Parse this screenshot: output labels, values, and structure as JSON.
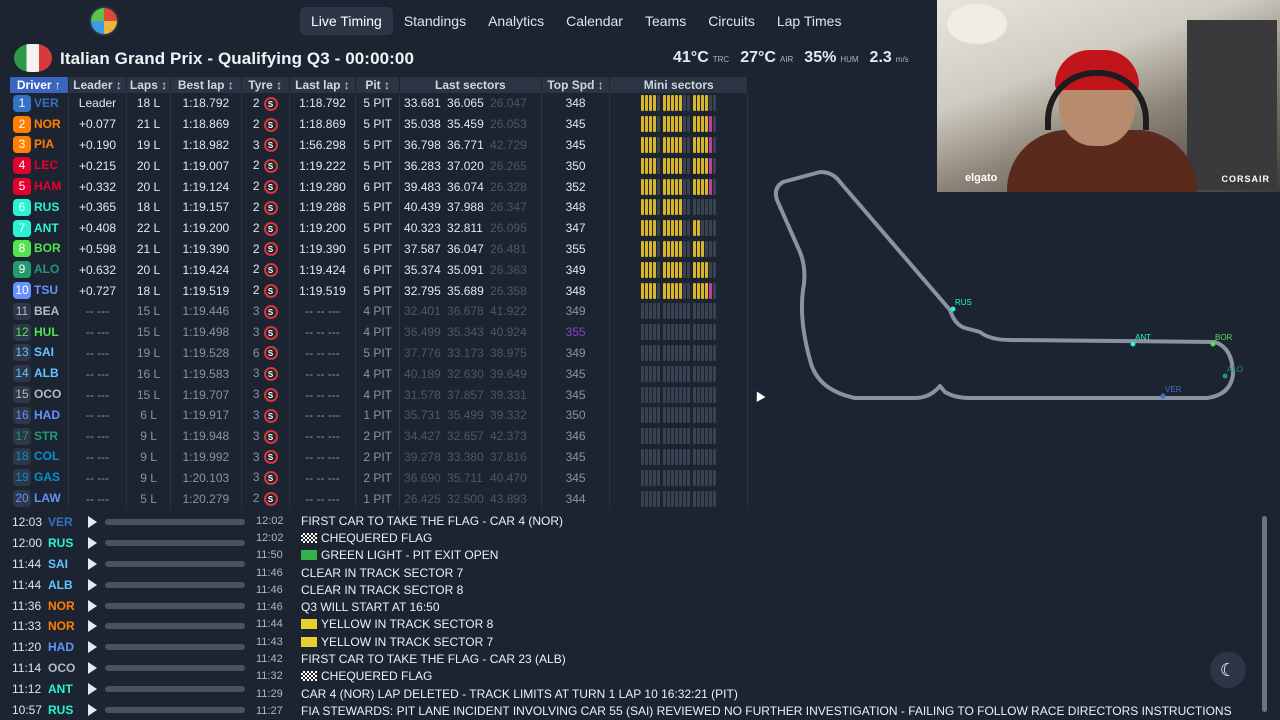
{
  "nav": {
    "items": [
      "Live Timing",
      "Standings",
      "Analytics",
      "Calendar",
      "Teams",
      "Circuits",
      "Lap Times"
    ],
    "active_index": 0
  },
  "header": {
    "session_title": "Italian Grand Prix - Qualifying Q3 - 00:00:00",
    "track_temp": "41°C",
    "track_temp_unit": "TRC",
    "air_temp": "27°C",
    "air_temp_unit": "AIR",
    "humidity": "35%",
    "humidity_unit": "HUM",
    "wind": "2.3",
    "wind_unit": "m/s"
  },
  "table": {
    "headers": [
      "Driver ↑",
      "Leader ↕",
      "Laps ↕",
      "Best lap ↕",
      "Tyre ↕",
      "Last lap ↕",
      "Pit ↕",
      "Last sectors",
      "Top Spd ↕",
      "Mini sectors"
    ],
    "rows": [
      {
        "pos": "1",
        "code": "VER",
        "color": "#3671c6",
        "leader": "Leader",
        "laps": "18 L",
        "best": "1:18.792",
        "best_cls": "purple",
        "tyre_n": "2",
        "last": "1:18.792",
        "last_cls": "purple",
        "pit": "5 PIT",
        "s1": "33.681",
        "s2": "36.065",
        "s3": "26.047",
        "spd": "348",
        "out": false,
        "minis": "yyyy yyyyy yyyy"
      },
      {
        "pos": "2",
        "code": "NOR",
        "color": "#ff8000",
        "leader": "+0.077",
        "laps": "21 L",
        "best": "1:18.869",
        "best_cls": "",
        "tyre_n": "2",
        "last": "1:18.869",
        "last_cls": "green",
        "pit": "5 PIT",
        "s1": "35.038",
        "s2": "35.459",
        "s3": "26.053",
        "spd": "345",
        "out": false,
        "minis": "yyyy yyyyy yyyyp"
      },
      {
        "pos": "3",
        "code": "PIA",
        "color": "#ff8000",
        "leader": "+0.190",
        "laps": "19 L",
        "best": "1:18.982",
        "best_cls": "",
        "tyre_n": "3",
        "last": "1:56.298",
        "last_cls": "",
        "pit": "5 PIT",
        "s1": "36.798",
        "s2": "36.771",
        "s3": "42.729",
        "spd": "345",
        "out": false,
        "minis": "yyyy yyyyy yyyyp"
      },
      {
        "pos": "4",
        "code": "LEC",
        "color": "#e8002d",
        "leader": "+0.215",
        "laps": "20 L",
        "best": "1:19.007",
        "best_cls": "",
        "tyre_n": "2",
        "last": "1:19.222",
        "last_cls": "",
        "pit": "5 PIT",
        "s1": "36.283",
        "s2": "37.020",
        "s3": "26.265",
        "spd": "350",
        "out": false,
        "minis": "yyyy yyyyy yyyyp"
      },
      {
        "pos": "5",
        "code": "HAM",
        "color": "#e8002d",
        "leader": "+0.332",
        "laps": "20 L",
        "best": "1:19.124",
        "best_cls": "",
        "tyre_n": "2",
        "last": "1:19.280",
        "last_cls": "",
        "pit": "6 PIT",
        "s1": "39.483",
        "s2": "36.074",
        "s3": "26.328",
        "spd": "352",
        "out": false,
        "minis": "yyyy yyyyy yyyyp"
      },
      {
        "pos": "6",
        "code": "RUS",
        "color": "#27f4d2",
        "leader": "+0.365",
        "laps": "18 L",
        "best": "1:19.157",
        "best_cls": "",
        "tyre_n": "2",
        "last": "1:19.288",
        "last_cls": "",
        "pit": "5 PIT",
        "s1": "40.439",
        "s2": "37.988",
        "s3": "26.347",
        "spd": "348",
        "out": false,
        "minis": "yyyy yyyyy ----"
      },
      {
        "pos": "7",
        "code": "ANT",
        "color": "#27f4d2",
        "leader": "+0.408",
        "laps": "22 L",
        "best": "1:19.200",
        "best_cls": "",
        "tyre_n": "2",
        "last": "1:19.200",
        "last_cls": "green",
        "pit": "5 PIT",
        "s1": "40.323",
        "s2": "32.811",
        "s3": "26.095",
        "spd": "347",
        "out": false,
        "minis": "yyyy yyyyy yy--"
      },
      {
        "pos": "8",
        "code": "BOR",
        "color": "#52e252",
        "leader": "+0.598",
        "laps": "21 L",
        "best": "1:19.390",
        "best_cls": "",
        "tyre_n": "2",
        "last": "1:19.390",
        "last_cls": "green",
        "pit": "5 PIT",
        "s1": "37.587",
        "s2": "36.047",
        "s3": "26.481",
        "spd": "355",
        "out": false,
        "minis": "yyyy yyyyy yyy-"
      },
      {
        "pos": "9",
        "code": "ALO",
        "color": "#229971",
        "leader": "+0.632",
        "laps": "20 L",
        "best": "1:19.424",
        "best_cls": "",
        "tyre_n": "2",
        "last": "1:19.424",
        "last_cls": "green",
        "pit": "6 PIT",
        "s1": "35.374",
        "s2": "35.091",
        "s3": "26.363",
        "spd": "349",
        "out": false,
        "minis": "yyyy yyyyy yyyy"
      },
      {
        "pos": "10",
        "code": "TSU",
        "color": "#6692ff",
        "leader": "+0.727",
        "laps": "18 L",
        "best": "1:19.519",
        "best_cls": "",
        "tyre_n": "2",
        "last": "1:19.519",
        "last_cls": "green",
        "pit": "5 PIT",
        "s1": "32.795",
        "s2": "35.689",
        "s3": "26.358",
        "spd": "348",
        "out": false,
        "minis": "yyyy yyyyy yyyyp"
      },
      {
        "pos": "11",
        "code": "BEA",
        "color": "#b6babd",
        "leader": "-- ---",
        "laps": "15 L",
        "best": "1:19.446",
        "best_cls": "",
        "tyre_n": "3",
        "last": "-- -- ---",
        "last_cls": "",
        "pit": "4 PIT",
        "s1": "32.401",
        "s2": "36.678",
        "s3": "41.922",
        "spd": "349",
        "out": true,
        "minis": "---- ----- ----"
      },
      {
        "pos": "12",
        "code": "HUL",
        "color": "#52e252",
        "leader": "-- ---",
        "laps": "15 L",
        "best": "1:19.498",
        "best_cls": "",
        "tyre_n": "3",
        "last": "-- -- ---",
        "last_cls": "",
        "pit": "4 PIT",
        "s1": "36.499",
        "s2": "35.343",
        "s3": "40.924",
        "spd": "355",
        "out": true,
        "minis": "---- ----- ----"
      },
      {
        "pos": "13",
        "code": "SAI",
        "color": "#64c4ff",
        "leader": "-- ---",
        "laps": "19 L",
        "best": "1:19.528",
        "best_cls": "",
        "tyre_n": "6",
        "last": "-- -- ---",
        "last_cls": "",
        "pit": "5 PIT",
        "s1": "37.776",
        "s2": "33.173",
        "s3": "38.975",
        "spd": "349",
        "out": true,
        "minis": "---- ----- ----"
      },
      {
        "pos": "14",
        "code": "ALB",
        "color": "#64c4ff",
        "leader": "-- ---",
        "laps": "16 L",
        "best": "1:19.583",
        "best_cls": "",
        "tyre_n": "3",
        "last": "-- -- ---",
        "last_cls": "",
        "pit": "4 PIT",
        "s1": "40.189",
        "s2": "32.630",
        "s3": "39.649",
        "spd": "345",
        "out": true,
        "minis": "---- ----- ----"
      },
      {
        "pos": "15",
        "code": "OCO",
        "color": "#b6babd",
        "leader": "-- ---",
        "laps": "15 L",
        "best": "1:19.707",
        "best_cls": "",
        "tyre_n": "3",
        "last": "-- -- ---",
        "last_cls": "",
        "pit": "4 PIT",
        "s1": "31.578",
        "s2": "37.857",
        "s3": "39.331",
        "spd": "345",
        "out": true,
        "minis": "---- ----- ----"
      },
      {
        "pos": "16",
        "code": "HAD",
        "color": "#6692ff",
        "leader": "-- ---",
        "laps": "6 L",
        "best": "1:19.917",
        "best_cls": "",
        "tyre_n": "3",
        "last": "-- -- ---",
        "last_cls": "",
        "pit": "1 PIT",
        "s1": "35.731",
        "s2": "35.499",
        "s3": "39.332",
        "spd": "350",
        "out": true,
        "minis": "---- ----- ----"
      },
      {
        "pos": "17",
        "code": "STR",
        "color": "#229971",
        "leader": "-- ---",
        "laps": "9 L",
        "best": "1:19.948",
        "best_cls": "",
        "tyre_n": "3",
        "last": "-- -- ---",
        "last_cls": "",
        "pit": "2 PIT",
        "s1": "34.427",
        "s2": "32.657",
        "s3": "42.373",
        "spd": "346",
        "out": true,
        "minis": "---- ----- ----"
      },
      {
        "pos": "18",
        "code": "COL",
        "color": "#0093cc",
        "leader": "-- ---",
        "laps": "9 L",
        "best": "1:19.992",
        "best_cls": "",
        "tyre_n": "3",
        "last": "-- -- ---",
        "last_cls": "",
        "pit": "2 PIT",
        "s1": "39.278",
        "s2": "33.380",
        "s3": "37.816",
        "spd": "345",
        "out": true,
        "minis": "---- ----- ----"
      },
      {
        "pos": "19",
        "code": "GAS",
        "color": "#0093cc",
        "leader": "-- ---",
        "laps": "9 L",
        "best": "1:20.103",
        "best_cls": "",
        "tyre_n": "3",
        "last": "-- -- ---",
        "last_cls": "",
        "pit": "2 PIT",
        "s1": "36.690",
        "s2": "35.711",
        "s3": "40.470",
        "spd": "345",
        "out": true,
        "minis": "---- ----- ----"
      },
      {
        "pos": "20",
        "code": "LAW",
        "color": "#6692ff",
        "leader": "-- ---",
        "laps": "5 L",
        "best": "1:20.279",
        "best_cls": "",
        "tyre_n": "2",
        "last": "-- -- ---",
        "last_cls": "",
        "pit": "1 PIT",
        "s1": "26.425",
        "s2": "32.500",
        "s3": "43.893",
        "spd": "344",
        "out": true,
        "minis": "---- ----- ----"
      }
    ]
  },
  "track": {
    "labels": [
      {
        "code": "RUS",
        "color": "#27f4d2"
      },
      {
        "code": "ANT",
        "color": "#27f4d2"
      },
      {
        "code": "BOR",
        "color": "#52e252"
      },
      {
        "code": "ALO",
        "color": "#229971"
      },
      {
        "code": "VER",
        "color": "#3671c6"
      }
    ]
  },
  "webcam": {
    "brand_left": "elgato",
    "brand_right": "CORSAIR"
  },
  "lap_list": [
    {
      "time": "12:03",
      "code": "VER",
      "color": "#3671c6"
    },
    {
      "time": "12:00",
      "code": "RUS",
      "color": "#27f4d2"
    },
    {
      "time": "11:44",
      "code": "SAI",
      "color": "#64c4ff"
    },
    {
      "time": "11:44",
      "code": "ALB",
      "color": "#64c4ff"
    },
    {
      "time": "11:36",
      "code": "NOR",
      "color": "#ff8000"
    },
    {
      "time": "11:33",
      "code": "NOR",
      "color": "#ff8000"
    },
    {
      "time": "11:20",
      "code": "HAD",
      "color": "#6692ff"
    },
    {
      "time": "11:14",
      "code": "OCO",
      "color": "#b6babd"
    },
    {
      "time": "11:12",
      "code": "ANT",
      "color": "#27f4d2"
    },
    {
      "time": "10:57",
      "code": "RUS",
      "color": "#27f4d2"
    }
  ],
  "race_control": [
    {
      "time": "12:02",
      "flag": "",
      "msg": "FIRST CAR TO TAKE THE FLAG - CAR 4 (NOR)"
    },
    {
      "time": "12:02",
      "flag": "chequered",
      "msg": "CHEQUERED FLAG"
    },
    {
      "time": "11:50",
      "flag": "green",
      "msg": "GREEN LIGHT - PIT EXIT OPEN"
    },
    {
      "time": "11:46",
      "flag": "",
      "msg": "CLEAR IN TRACK SECTOR 7"
    },
    {
      "time": "11:46",
      "flag": "",
      "msg": "CLEAR IN TRACK SECTOR 8"
    },
    {
      "time": "11:46",
      "flag": "",
      "msg": "Q3 WILL START AT 16:50"
    },
    {
      "time": "11:44",
      "flag": "yellow",
      "msg": "YELLOW IN TRACK SECTOR 8"
    },
    {
      "time": "11:43",
      "flag": "yellow",
      "msg": "YELLOW IN TRACK SECTOR 7"
    },
    {
      "time": "11:42",
      "flag": "",
      "msg": "FIRST CAR TO TAKE THE FLAG - CAR 23 (ALB)"
    },
    {
      "time": "11:32",
      "flag": "chequered",
      "msg": "CHEQUERED FLAG"
    },
    {
      "time": "11:29",
      "flag": "",
      "msg": "CAR 4 (NOR) LAP DELETED - TRACK LIMITS AT TURN 1 LAP 10 16:32:21 (PIT)"
    },
    {
      "time": "11:27",
      "flag": "",
      "msg": "FIA STEWARDS: PIT LANE INCIDENT INVOLVING CAR 55 (SAI) REVIEWED NO FURTHER INVESTIGATION - FAILING TO FOLLOW RACE DIRECTORS INSTRUCTIONS"
    }
  ]
}
